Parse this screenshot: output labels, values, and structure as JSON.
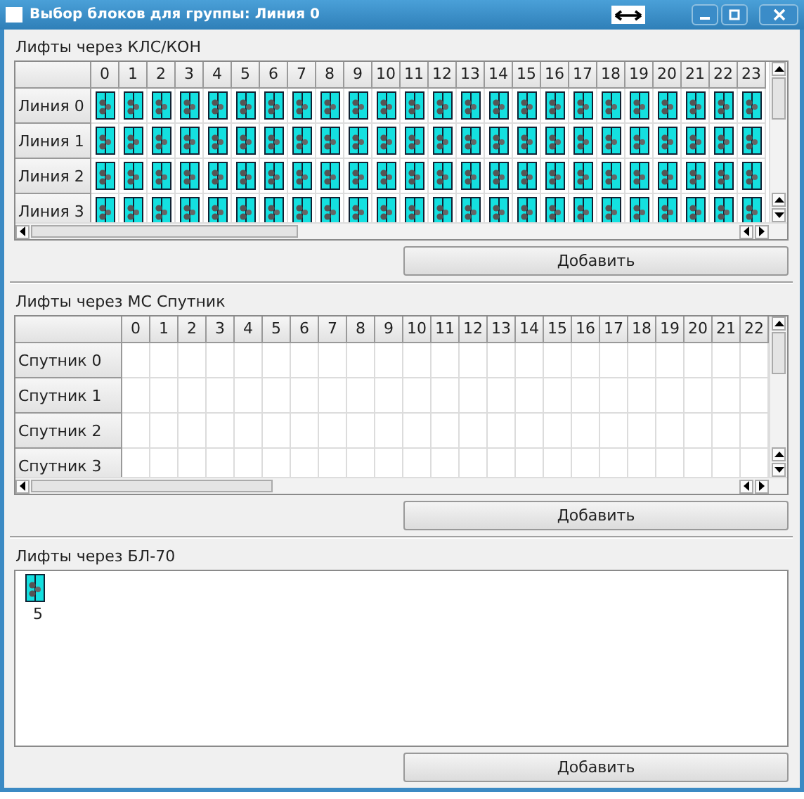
{
  "window": {
    "title": "Выбор блоков для группы: Линия 0"
  },
  "sections": [
    {
      "kind": "grid",
      "label": "Лифты через КЛС/КОН",
      "columns": [
        "0",
        "1",
        "2",
        "3",
        "4",
        "5",
        "6",
        "7",
        "8",
        "9",
        "10",
        "11",
        "12",
        "13",
        "14",
        "15",
        "16",
        "17",
        "18",
        "19",
        "20",
        "21",
        "22",
        "23"
      ],
      "rows": [
        {
          "header": "Линия 0",
          "lifts": [
            true,
            true,
            true,
            true,
            true,
            true,
            true,
            true,
            true,
            true,
            true,
            true,
            true,
            true,
            true,
            true,
            true,
            true,
            true,
            true,
            true,
            true,
            true,
            true
          ]
        },
        {
          "header": "Линия 1",
          "lifts": [
            true,
            true,
            true,
            true,
            true,
            true,
            true,
            true,
            true,
            true,
            true,
            true,
            true,
            true,
            true,
            true,
            true,
            true,
            true,
            true,
            true,
            true,
            true,
            true
          ]
        },
        {
          "header": "Линия 2",
          "lifts": [
            true,
            true,
            true,
            true,
            true,
            true,
            true,
            true,
            true,
            true,
            true,
            true,
            true,
            true,
            true,
            true,
            true,
            true,
            true,
            true,
            true,
            true,
            true,
            true
          ]
        },
        {
          "header": "Линия 3",
          "lifts": [
            true,
            true,
            true,
            true,
            true,
            true,
            true,
            true,
            true,
            true,
            true,
            true,
            true,
            true,
            true,
            true,
            true,
            true,
            true,
            true,
            true,
            true,
            true,
            true
          ]
        }
      ],
      "button": "Добавить"
    },
    {
      "kind": "grid",
      "label": "Лифты через МС Спутник",
      "columns": [
        "0",
        "1",
        "2",
        "3",
        "4",
        "5",
        "6",
        "7",
        "8",
        "9",
        "10",
        "11",
        "12",
        "13",
        "14",
        "15",
        "16",
        "17",
        "18",
        "19",
        "20",
        "21",
        "22"
      ],
      "rows": [
        {
          "header": "Спутник 0",
          "lifts": [
            false,
            false,
            false,
            false,
            false,
            false,
            false,
            false,
            false,
            false,
            false,
            false,
            false,
            false,
            false,
            false,
            false,
            false,
            false,
            false,
            false,
            false,
            false
          ]
        },
        {
          "header": "Спутник 1",
          "lifts": [
            false,
            false,
            false,
            false,
            false,
            false,
            false,
            false,
            false,
            false,
            false,
            false,
            false,
            false,
            false,
            false,
            false,
            false,
            false,
            false,
            false,
            false,
            false
          ]
        },
        {
          "header": "Спутник 2",
          "lifts": [
            false,
            false,
            false,
            false,
            false,
            false,
            false,
            false,
            false,
            false,
            false,
            false,
            false,
            false,
            false,
            false,
            false,
            false,
            false,
            false,
            false,
            false,
            false
          ]
        },
        {
          "header": "Спутник 3",
          "lifts": [
            false,
            false,
            false,
            false,
            false,
            false,
            false,
            false,
            false,
            false,
            false,
            false,
            false,
            false,
            false,
            false,
            false,
            false,
            false,
            false,
            false,
            false,
            false
          ]
        }
      ],
      "button": "Добавить"
    },
    {
      "kind": "list",
      "label": "Лифты через БЛ-70",
      "items": [
        {
          "label": "5"
        }
      ],
      "button": "Добавить"
    }
  ]
}
